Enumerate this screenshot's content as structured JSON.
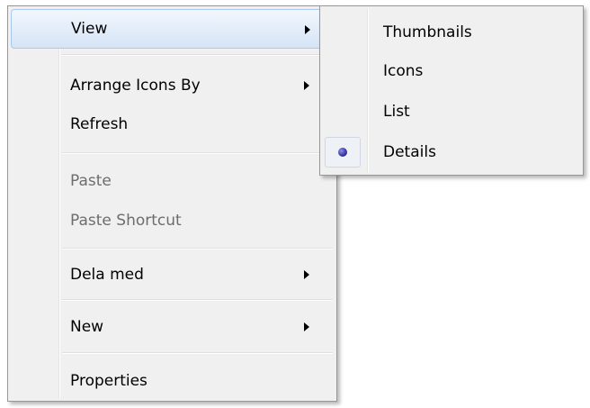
{
  "context_menu": {
    "items": [
      {
        "label": "View",
        "has_submenu": true,
        "enabled": true,
        "hovered": true
      },
      {
        "label": "Arrange Icons By",
        "has_submenu": true,
        "enabled": true
      },
      {
        "label": "Refresh",
        "has_submenu": false,
        "enabled": true
      },
      {
        "label": "Paste",
        "has_submenu": false,
        "enabled": false
      },
      {
        "label": "Paste Shortcut",
        "has_submenu": false,
        "enabled": false
      },
      {
        "label": "Dela med",
        "has_submenu": true,
        "enabled": true
      },
      {
        "label": "New",
        "has_submenu": true,
        "enabled": true
      },
      {
        "label": "Properties",
        "has_submenu": false,
        "enabled": true
      }
    ]
  },
  "view_submenu": {
    "items": [
      {
        "label": "Thumbnails",
        "selected": false
      },
      {
        "label": "Icons",
        "selected": false
      },
      {
        "label": "List",
        "selected": false
      },
      {
        "label": "Details",
        "selected": true
      }
    ]
  },
  "colors": {
    "menu_background": "#f0f0f0",
    "menu_border": "#979797",
    "hover_border": "#a8c7ef",
    "disabled_text": "#6d6d6d",
    "radio_dot": "#3a3aa8"
  },
  "icons": {
    "submenu_arrow": "chevron-right-icon",
    "selected_marker": "radio-dot-icon"
  }
}
